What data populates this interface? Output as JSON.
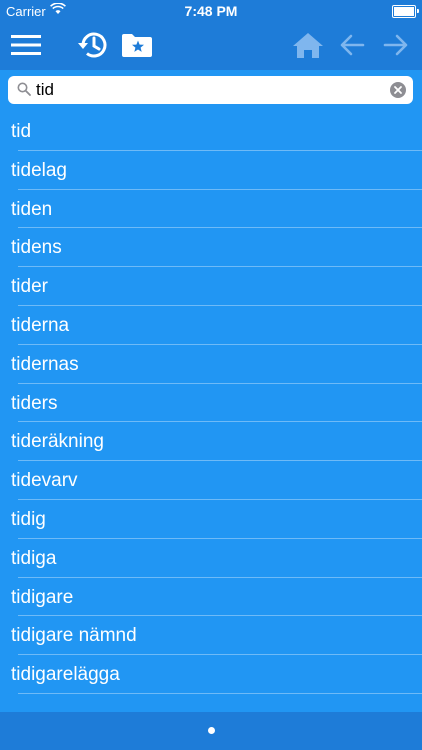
{
  "status": {
    "carrier": "Carrier",
    "time": "7:48 PM"
  },
  "toolbar": {
    "icons": [
      "menu-icon",
      "history-icon",
      "favorites-folder-icon",
      "home-icon",
      "back-arrow-icon",
      "forward-arrow-icon"
    ]
  },
  "search": {
    "value": "tid",
    "placeholder": ""
  },
  "results": [
    "tid",
    "tidelag",
    "tiden",
    "tidens",
    "tider",
    "tiderna",
    "tidernas",
    "tiders",
    "tideräkning",
    "tidevarv",
    "tidig",
    "tidiga",
    "tidigare",
    "tidigare nämnd",
    "tidigarelägga"
  ],
  "pager": {
    "current": 1,
    "total": 1
  },
  "colors": {
    "background": "#2196F3",
    "bar": "#1E7CD8",
    "text": "#FFFFFF",
    "disabled_icon": "#7FB6EE"
  }
}
